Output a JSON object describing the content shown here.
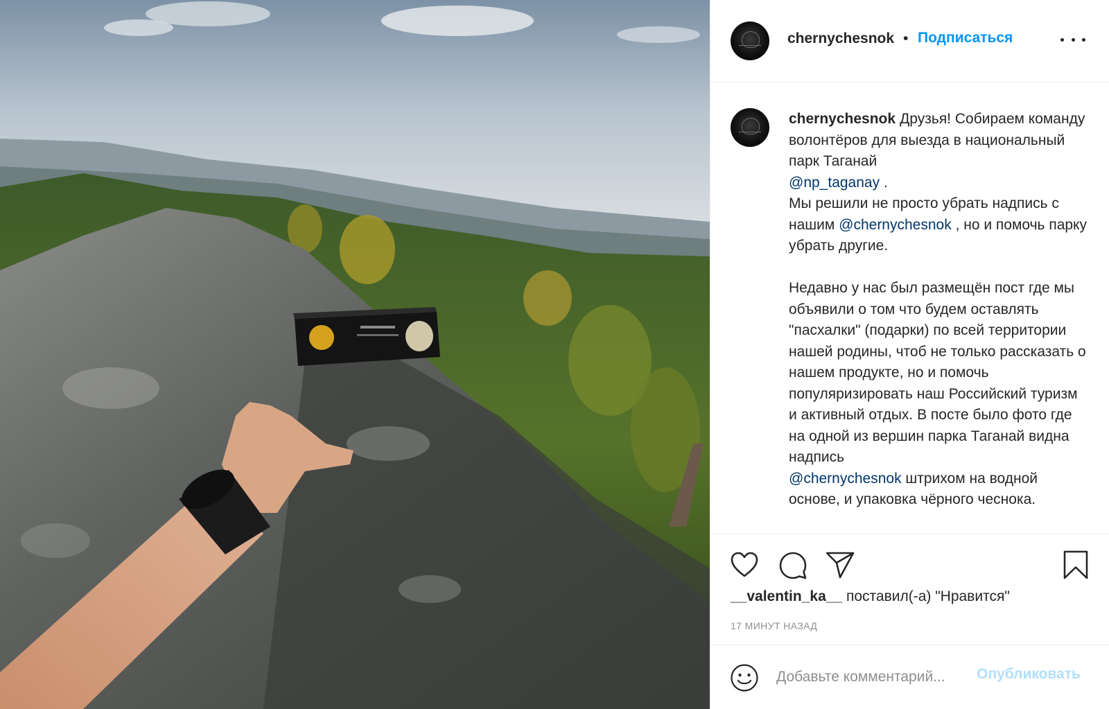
{
  "post": {
    "author": "chernychesnok",
    "separator": "•",
    "follow_label": "Подписаться",
    "caption_intro": "Друзья! Собираем команду волонтёров для выезда в национальный парк Таганай",
    "mention_1": "@np_taganay",
    "mention_1_after": ".",
    "caption_line2_before": "Мы решили не просто убрать надпись с нашим",
    "mention_2": "@chernychesnok",
    "mention_2_after": ", но и помочь парку убрать другие.",
    "caption_para2": "Недавно у нас был размещён пост где мы объявили о том что будем оставлять \"пасхалки\" (подарки) по всей территории нашей родины, чтоб не только рассказать о нашем продукте, но и помочь популяризировать наш Российский туризм и активный отдых. В посте было фото где на одной из вершин парка Таганай видна надпись",
    "mention_3": "@chernychesnok",
    "caption_para2_after": "штрихом на водной основе, и упаковка чёрного чеснока."
  },
  "actions": {
    "like_icon": "heart-icon",
    "comment_icon": "speech-bubble-icon",
    "share_icon": "paper-plane-icon",
    "save_icon": "bookmark-icon",
    "liker": "__valentin_ka__",
    "liked_text": "поставил(-а) \"Нравится\"",
    "time_ago": "17 МИНУТ НАЗАД"
  },
  "comment": {
    "emoji_icon": "smiley-icon",
    "placeholder": "Добавьте комментарий...",
    "publish_label": "Опубликовать"
  },
  "colors": {
    "link_blue": "#0095f6",
    "mention_blue": "#00376b",
    "publish_disabled": "#b2dffc",
    "muted": "#8e8e8e"
  }
}
